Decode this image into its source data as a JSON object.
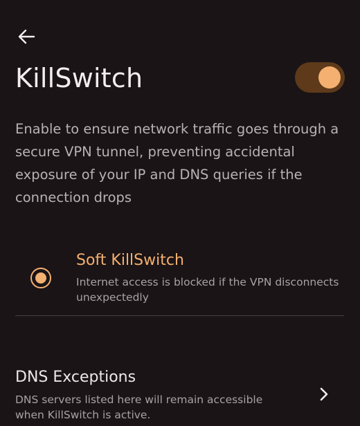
{
  "header": {
    "back_icon": "arrow-left-icon",
    "title": "KillSwitch"
  },
  "killswitch_toggle": {
    "state": "on",
    "track_color": "#5e3a1a",
    "knob_color": "#f4b070"
  },
  "description": "Enable to ensure network traffic goes through a secure VPN tunnel, preventing accidental exposure of your IP and DNS queries if the connection drops",
  "options": [
    {
      "selected": true,
      "label": "Soft KillSwitch",
      "description": "Internet access is blocked if the VPN disconnects unexpectedly"
    }
  ],
  "dns_exceptions": {
    "title": "DNS Exceptions",
    "description": "DNS servers listed here will remain accessible when KillSwitch is active.",
    "icon": "chevron-right-icon"
  },
  "colors": {
    "background": "#1a1416",
    "accent": "#f4b070",
    "text_primary": "#ece8ea",
    "text_secondary": "#a9a2a5"
  }
}
